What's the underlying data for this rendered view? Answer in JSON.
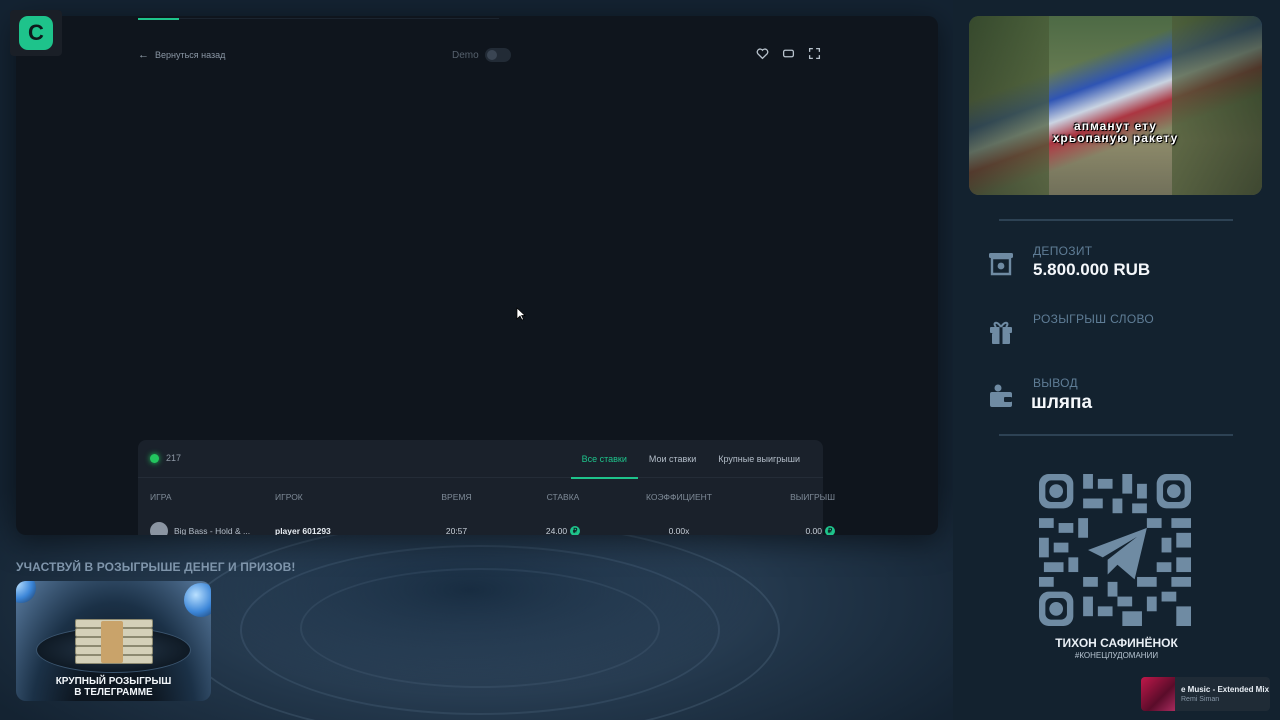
{
  "logo": {
    "letter": "C"
  },
  "game": {
    "back_label": "Вернуться назад",
    "demo_label": "Demo"
  },
  "bets": {
    "online_count": "217",
    "tabs": [
      "Все ставки",
      "Мои ставки",
      "Крупные выигрыши"
    ],
    "active_tab": "Все ставки",
    "columns": [
      "ИГРА",
      "ИГРОК",
      "ВРЕМЯ",
      "СТАВКА",
      "КОЭФФИЦИЕНТ",
      "ВЫИГРЫШ"
    ],
    "rows": [
      {
        "game": "Big Bass - Hold & ...",
        "player": "player 601293",
        "time": "20:57",
        "bet": "24.00",
        "coef": "0.00x",
        "win": "0.00"
      }
    ],
    "currency_glyph": "₽"
  },
  "promo": {
    "title": "УЧАСТВУЙ В РОЗЫГРЫШЕ ДЕНЕГ И ПРИЗОВ!",
    "caption_line1": "КРУПНЫЙ РОЗЫГРЫШ",
    "caption_line2": "В ТЕЛЕГРАММЕ"
  },
  "sidebar": {
    "video_caption_line1": "апманут ету",
    "video_caption_line2": "хрьопаную ракету",
    "deposit": {
      "label": "ДЕПОЗИТ",
      "value": "5.800.000 RUB"
    },
    "giveaway": {
      "label": "РОЗЫГРЫШ СЛОВО"
    },
    "withdraw": {
      "label": "ВЫВОД",
      "value": "шляпа"
    },
    "qr_name": "ТИХОН САФИНЁНОК",
    "qr_tag": "#КОНЕЦЛУДОМАНИИ",
    "music": {
      "title": "e Music - Extended Mix",
      "artist": "Remi Siman"
    }
  },
  "colors": {
    "accent": "#1ec38b",
    "online": "#22c55e"
  }
}
